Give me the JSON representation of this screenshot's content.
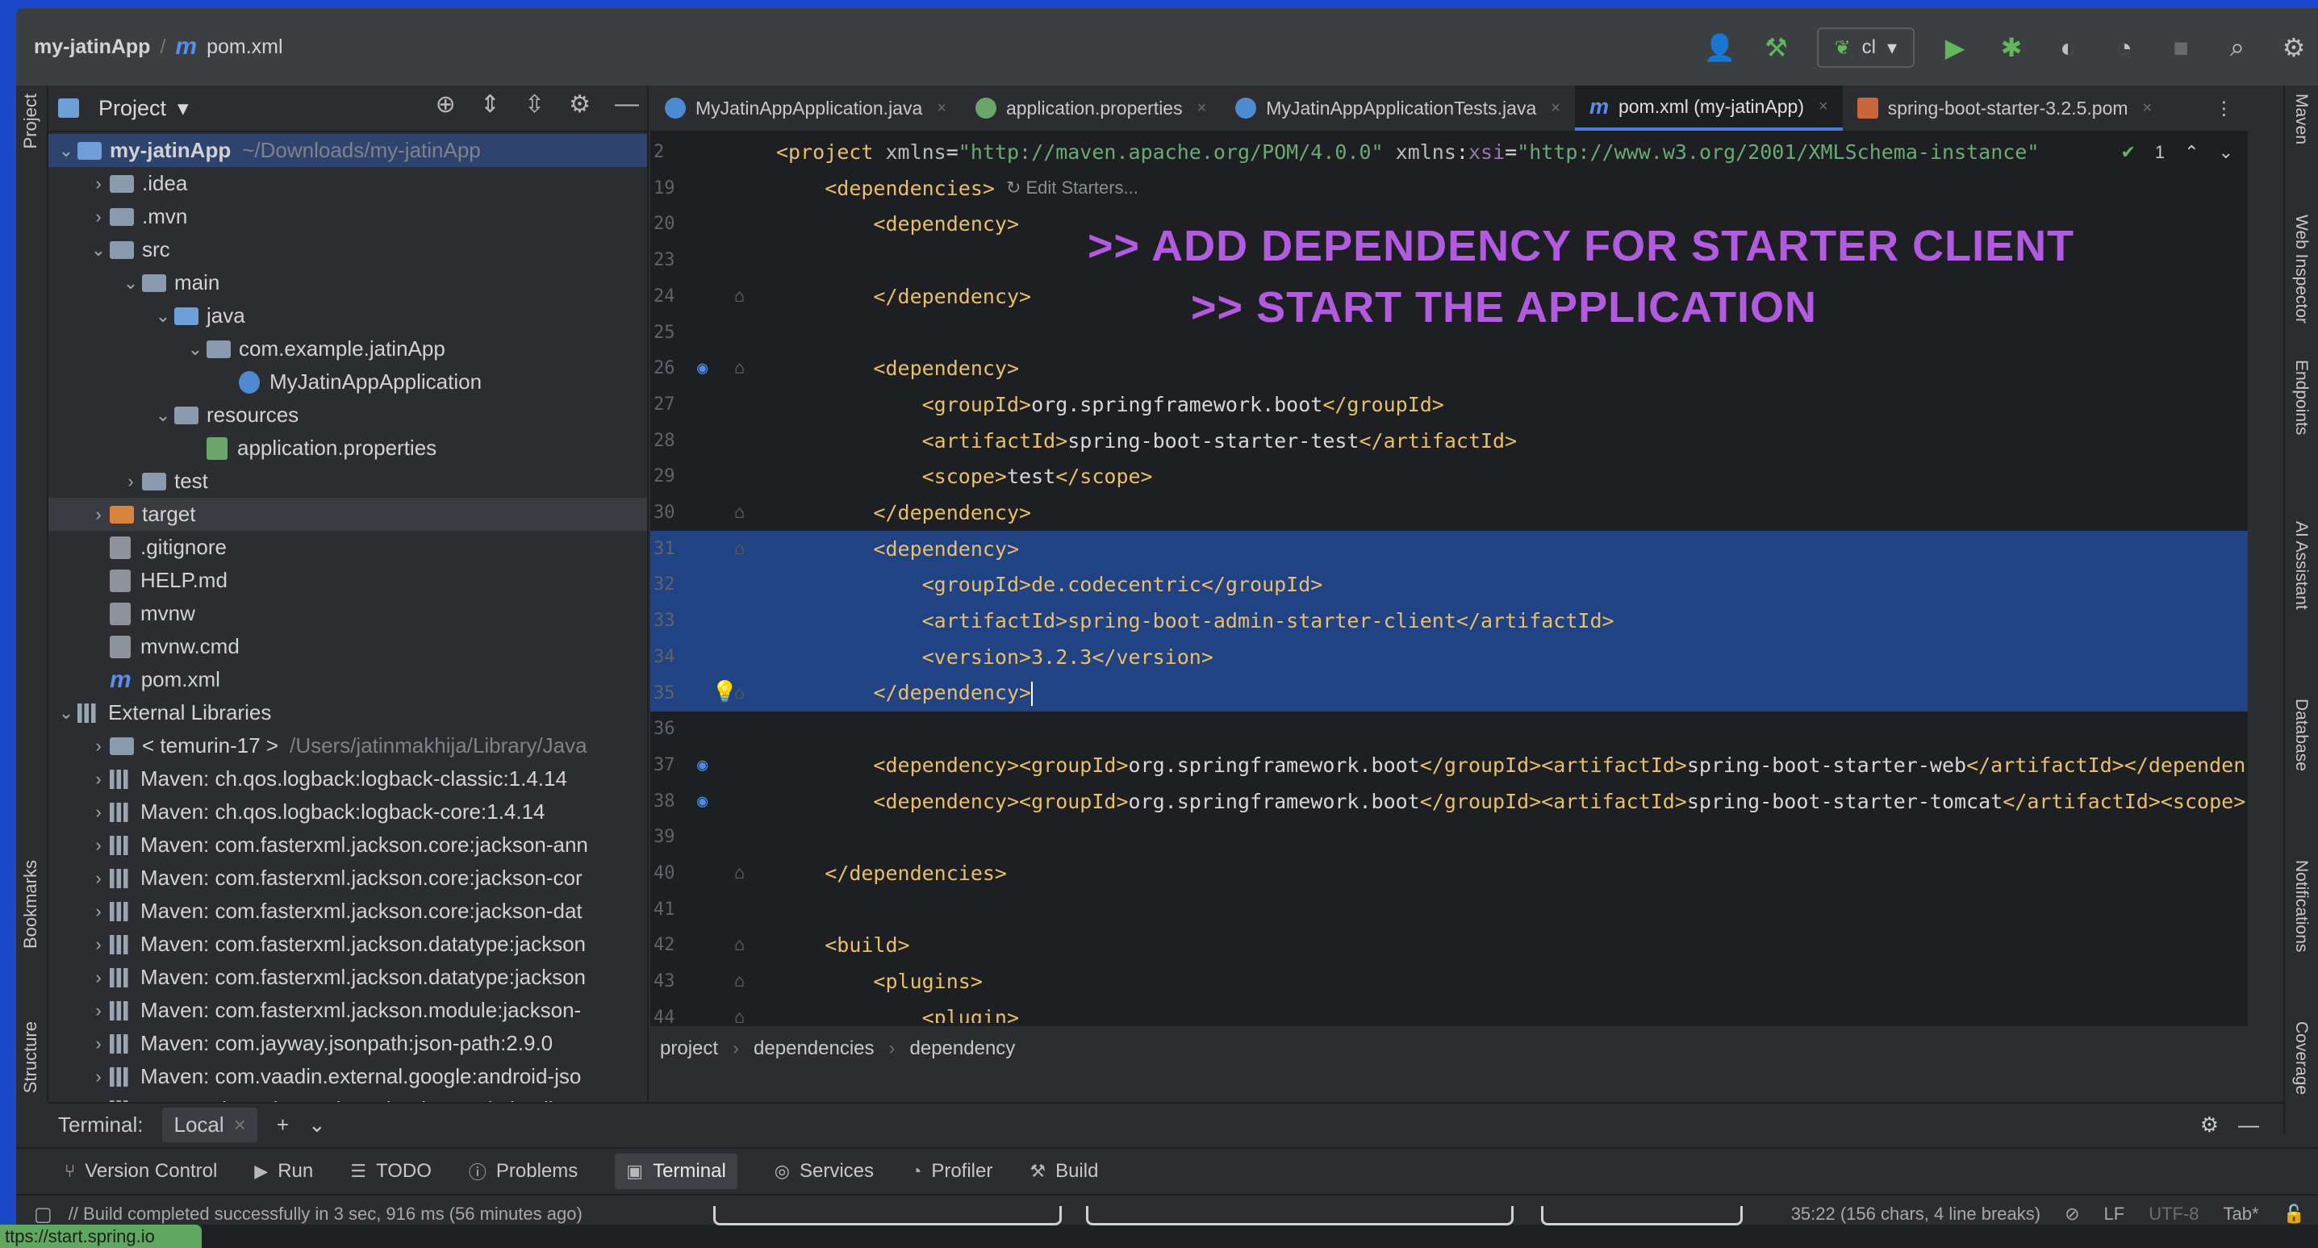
{
  "titlebar": {
    "project": "my-jatinApp",
    "file": "pom.xml",
    "run_config": "cl",
    "icons": [
      "user-icon",
      "hammer-icon",
      "run-icon",
      "debug-icon",
      "coverage-icon",
      "profile-icon",
      "stop-icon",
      "search-icon",
      "gear-icon"
    ]
  },
  "left_strip": {
    "project_label": "Project",
    "bookmarks_label": "Bookmarks",
    "structure_label": "Structure"
  },
  "project_panel": {
    "title": "Project",
    "tree": [
      {
        "label": "my-jatinApp",
        "path": "~/Downloads/my-jatinApp",
        "level": 0,
        "open": true,
        "type": "module"
      },
      {
        "label": ".idea",
        "level": 1,
        "open": false,
        "type": "folder"
      },
      {
        "label": ".mvn",
        "level": 1,
        "open": false,
        "type": "folder"
      },
      {
        "label": "src",
        "level": 1,
        "open": true,
        "type": "folder"
      },
      {
        "label": "main",
        "level": 2,
        "open": true,
        "type": "folder"
      },
      {
        "label": "java",
        "level": 3,
        "open": true,
        "type": "folder-blue"
      },
      {
        "label": "com.example.jatinApp",
        "level": 4,
        "open": true,
        "type": "package"
      },
      {
        "label": "MyJatinAppApplication",
        "level": 5,
        "type": "class"
      },
      {
        "label": "resources",
        "level": 3,
        "open": true,
        "type": "folder"
      },
      {
        "label": "application.properties",
        "level": 4,
        "type": "props"
      },
      {
        "label": "test",
        "level": 2,
        "open": false,
        "type": "folder"
      },
      {
        "label": "target",
        "level": 1,
        "open": false,
        "type": "folder-orange"
      },
      {
        "label": ".gitignore",
        "level": 1,
        "type": "file"
      },
      {
        "label": "HELP.md",
        "level": 1,
        "type": "file"
      },
      {
        "label": "mvnw",
        "level": 1,
        "type": "file"
      },
      {
        "label": "mvnw.cmd",
        "level": 1,
        "type": "file"
      },
      {
        "label": "pom.xml",
        "level": 1,
        "type": "maven"
      },
      {
        "label": "External Libraries",
        "level": 0,
        "open": true,
        "type": "libs"
      },
      {
        "label": "< temurin-17 >",
        "path": "/Users/jatinmakhija/Library/Java",
        "level": 1,
        "open": false,
        "type": "jdk"
      },
      {
        "label": "Maven: ch.qos.logback:logback-classic:1.4.14",
        "level": 1,
        "open": false,
        "type": "lib"
      },
      {
        "label": "Maven: ch.qos.logback:logback-core:1.4.14",
        "level": 1,
        "open": false,
        "type": "lib"
      },
      {
        "label": "Maven: com.fasterxml.jackson.core:jackson-ann",
        "level": 1,
        "open": false,
        "type": "lib"
      },
      {
        "label": "Maven: com.fasterxml.jackson.core:jackson-cor",
        "level": 1,
        "open": false,
        "type": "lib"
      },
      {
        "label": "Maven: com.fasterxml.jackson.core:jackson-dat",
        "level": 1,
        "open": false,
        "type": "lib"
      },
      {
        "label": "Maven: com.fasterxml.jackson.datatype:jackson",
        "level": 1,
        "open": false,
        "type": "lib"
      },
      {
        "label": "Maven: com.fasterxml.jackson.datatype:jackson",
        "level": 1,
        "open": false,
        "type": "lib"
      },
      {
        "label": "Maven: com.fasterxml.jackson.module:jackson-",
        "level": 1,
        "open": false,
        "type": "lib"
      },
      {
        "label": "Maven: com.jayway.jsonpath:json-path:2.9.0",
        "level": 1,
        "open": false,
        "type": "lib"
      },
      {
        "label": "Maven: com.vaadin.external.google:android-jso",
        "level": 1,
        "open": false,
        "type": "lib"
      },
      {
        "label": "Maven: de.codecentric:spring-boot-admin-clier",
        "level": 1,
        "open": false,
        "type": "lib"
      }
    ]
  },
  "editor": {
    "tabs": [
      {
        "label": "MyJatinAppApplication.java",
        "icon": "class",
        "active": false
      },
      {
        "label": "application.properties",
        "icon": "leaf",
        "active": false
      },
      {
        "label": "MyJatinAppApplicationTests.java",
        "icon": "class",
        "active": false
      },
      {
        "label": "pom.xml (my-jatinApp)",
        "icon": "maven",
        "active": true
      },
      {
        "label": "spring-boot-starter-3.2.5.pom",
        "icon": "pom",
        "active": false
      }
    ],
    "inspection_count": "1",
    "edit_starters": "Edit Starters...",
    "lines": [
      {
        "n": "2",
        "html": "<span class=\"t-tag\">&lt;project </span><span class=\"t-attr\">xmlns</span><span class=\"t-text\">=</span><span class=\"t-val\">\"http://maven.apache.org/POM/4.0.0\"</span><span class=\"t-text\"> </span><span class=\"t-attr\">xmlns</span><span class=\"t-text\">:</span><span class=\"t-ns\">xsi</span><span class=\"t-text\">=</span><span class=\"t-val\">\"http://www.w3.org/2001/XMLSchema-instance\"</span>"
      },
      {
        "n": "19",
        "html": "    <span class=\"t-tag\">&lt;dependencies&gt;</span>",
        "hint": true
      },
      {
        "n": "20",
        "html": "        <span class=\"t-tag\">&lt;dependency&gt;</span>"
      },
      {
        "n": "23",
        "html": ""
      },
      {
        "n": "24",
        "html": "        <span class=\"t-tag\">&lt;/dependency&gt;</span>",
        "fold": true
      },
      {
        "n": "25",
        "html": ""
      },
      {
        "n": "26",
        "html": "        <span class=\"t-tag\">&lt;dependency&gt;</span>",
        "gicon": true,
        "fold": true
      },
      {
        "n": "27",
        "html": "            <span class=\"t-tag\">&lt;groupId&gt;</span><span class=\"t-text\">org.springframework.boot</span><span class=\"t-tag\">&lt;/groupId&gt;</span>"
      },
      {
        "n": "28",
        "html": "            <span class=\"t-tag\">&lt;artifactId&gt;</span><span class=\"t-text\">spring-boot-starter-test</span><span class=\"t-tag\">&lt;/artifactId&gt;</span>"
      },
      {
        "n": "29",
        "html": "            <span class=\"t-tag\">&lt;scope&gt;</span><span class=\"t-text\">test</span><span class=\"t-tag\">&lt;/scope&gt;</span>"
      },
      {
        "n": "30",
        "html": "        <span class=\"t-tag\">&lt;/dependency&gt;</span>",
        "fold": true
      },
      {
        "n": "31",
        "html": "        <span class=\"t-tag\">&lt;dependency&gt;</span>",
        "sel": true,
        "fold": true
      },
      {
        "n": "32",
        "html": "            <span class=\"t-tag\">&lt;groupId&gt;</span><span class=\"t-text\">de.codecentric</span><span class=\"t-tag\">&lt;/groupId&gt;</span>",
        "sel": true
      },
      {
        "n": "33",
        "html": "            <span class=\"t-tag\">&lt;artifactId&gt;</span><span class=\"t-text\">spring-boot-admin-starter-client</span><span class=\"t-tag\">&lt;/artifactId&gt;</span>",
        "sel": true
      },
      {
        "n": "34",
        "html": "            <span class=\"t-tag\">&lt;version&gt;</span><span class=\"t-text\">3.2.3</span><span class=\"t-tag\">&lt;/version&gt;</span>",
        "sel": true
      },
      {
        "n": "35",
        "html": "        <span class=\"t-tag\">&lt;/dependency&gt;</span><span class=\"caret\"></span>",
        "sel": true,
        "bulb": true,
        "fold": true
      },
      {
        "n": "36",
        "html": ""
      },
      {
        "n": "37",
        "html": "        <span class=\"t-tag\">&lt;dependency&gt;&lt;groupId&gt;</span><span class=\"t-text\">org.springframework.boot</span><span class=\"t-tag\">&lt;/groupId&gt;&lt;artifactId&gt;</span><span class=\"t-text\">spring-boot-starter-web</span><span class=\"t-tag\">&lt;/artifactId&gt;&lt;/dependen</span>",
        "gicon": true
      },
      {
        "n": "38",
        "html": "        <span class=\"t-tag\">&lt;dependency&gt;&lt;groupId&gt;</span><span class=\"t-text\">org.springframework.boot</span><span class=\"t-tag\">&lt;/groupId&gt;&lt;artifactId&gt;</span><span class=\"t-text\">spring-boot-starter-tomcat</span><span class=\"t-tag\">&lt;/artifactId&gt;&lt;scope&gt;</span>",
        "gicon": true
      },
      {
        "n": "39",
        "html": ""
      },
      {
        "n": "40",
        "html": "    <span class=\"t-tag\">&lt;/dependencies&gt;</span>",
        "fold": true
      },
      {
        "n": "41",
        "html": ""
      },
      {
        "n": "42",
        "html": "    <span class=\"t-tag\">&lt;build&gt;</span>",
        "fold": true
      },
      {
        "n": "43",
        "html": "        <span class=\"t-tag\">&lt;plugins&gt;</span>",
        "fold": true
      },
      {
        "n": "44",
        "html": "            <span class=\"t-tag\">&lt;plugin&gt;</span>",
        "fold": true
      }
    ],
    "annotations": [
      ">> ADD DEPENDENCY FOR STARTER CLIENT",
      ">> START THE APPLICATION"
    ],
    "breadcrumbs": [
      "project",
      "dependencies",
      "dependency"
    ]
  },
  "right_strip": [
    "Maven",
    "Web Inspector",
    "Endpoints",
    "AI Assistant",
    "Database",
    "Notifications",
    "Coverage"
  ],
  "terminal": {
    "label": "Terminal:",
    "tab": "Local"
  },
  "toolwindows": [
    {
      "label": "Version Control",
      "icon": "branch-icon"
    },
    {
      "label": "Run",
      "icon": "run-icon"
    },
    {
      "label": "TODO",
      "icon": "list-icon"
    },
    {
      "label": "Problems",
      "icon": "info-icon"
    },
    {
      "label": "Terminal",
      "icon": "terminal-icon",
      "active": true
    },
    {
      "label": "Services",
      "icon": "services-icon"
    },
    {
      "label": "Profiler",
      "icon": "profiler-icon"
    },
    {
      "label": "Build",
      "icon": "hammer-icon"
    }
  ],
  "statusbar": {
    "message": "// Build completed successfully in 3 sec, 916 ms (56 minutes ago)",
    "position": "35:22 (156 chars, 4 line breaks)",
    "line_sep": "LF",
    "encoding": "UTF-8",
    "indent": "Tab*"
  },
  "url_chip": "ttps://start.spring.io"
}
